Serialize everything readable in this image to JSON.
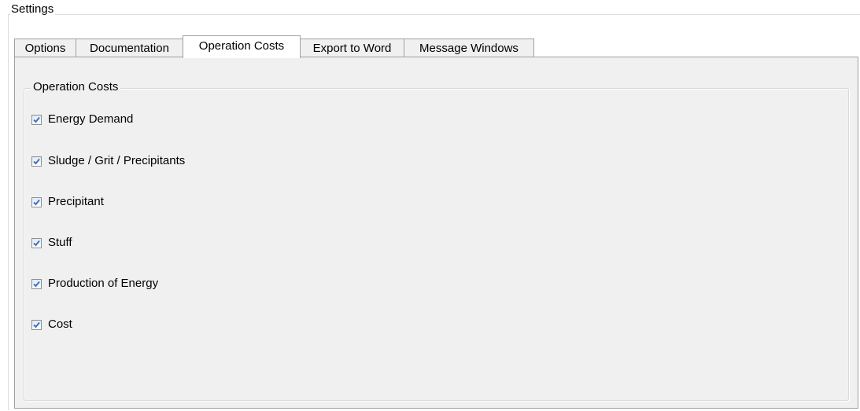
{
  "window": {
    "group_title": "Settings"
  },
  "tabs": [
    {
      "label": "Options",
      "selected": false
    },
    {
      "label": "Documentation",
      "selected": false
    },
    {
      "label": "Operation Costs",
      "selected": true
    },
    {
      "label": "Export to Word",
      "selected": false
    },
    {
      "label": "Message Windows",
      "selected": false
    }
  ],
  "operation_costs": {
    "group_title": "Operation Costs",
    "checkboxes": [
      {
        "label": "Energy Demand",
        "checked": true
      },
      {
        "label": "Sludge / Grit / Precipitants",
        "checked": true
      },
      {
        "label": "Precipitant",
        "checked": true
      },
      {
        "label": "Stuff",
        "checked": true
      },
      {
        "label": "Production of Energy",
        "checked": true
      },
      {
        "label": "Cost",
        "checked": true
      }
    ]
  },
  "colors": {
    "checkmark": "#4a6fb5",
    "panel_background": "#f0f0f0",
    "tab_border": "#a0a0a0"
  }
}
